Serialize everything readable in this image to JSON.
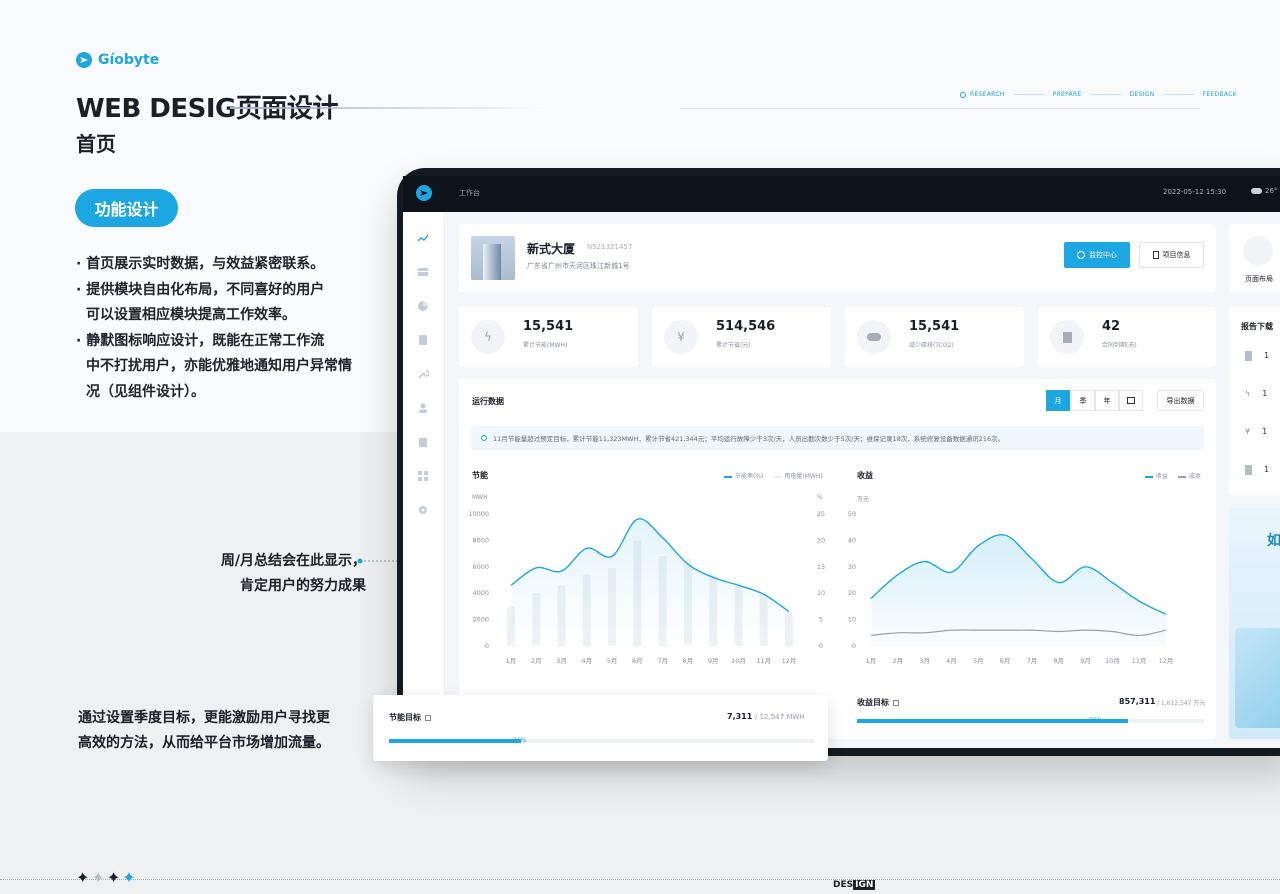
{
  "brand": {
    "name": "Gíobyte"
  },
  "header": {
    "title": "WEB DESIG页面设计",
    "subtitle": "首页"
  },
  "steps": [
    "RESEARCH",
    "PREPARE",
    "DESIGN",
    "FEEDBACK"
  ],
  "left": {
    "button": "功能设计",
    "bullets": [
      "· 首页展示实时数据，与效益紧密联系。",
      "· 提供模块自由化布局，不同喜好的用户",
      "  可以设置相应模块提高工作效率。",
      "· 静默图标响应设计，既能在正常工作流",
      "  中不打扰用户，亦能优雅地通知用户异常情",
      "  况（见组件设计）。"
    ],
    "note1": [
      "周/月总结会在此显示，",
      "肯定用户的努力成果"
    ],
    "note2": [
      "通过设置季度目标，更能激励用户寻找更",
      "高效的方法，从而给平台市场增加流量。"
    ]
  },
  "app": {
    "topbar": {
      "section": "工作台",
      "datetime": "2022-05-12  15:30",
      "weather": "26°"
    },
    "project": {
      "name": "新式大厦",
      "id": "NS21321457",
      "address": "广东省广州市天河区珠江新城1号",
      "monitor_btn": "监控中心",
      "info_btn": "项目信息"
    },
    "stats": [
      {
        "icon": "lightning-icon",
        "value": "15,541",
        "label": "累计节能(MWH)"
      },
      {
        "icon": "yen-icon",
        "value": "514,546",
        "label": "累计节省(元)"
      },
      {
        "icon": "cloud-icon",
        "value": "15,541",
        "label": "减少碳排(TCO2)"
      },
      {
        "icon": "document-icon",
        "value": "42",
        "label": "合同到期(天)"
      }
    ],
    "runtime": {
      "title": "运行数据",
      "periods": [
        "月",
        "季",
        "年"
      ],
      "export": "导出数据",
      "notice": "11月节能量超过预定目标，累计节能11,323MWH，累计节省421,344元；平均运行故障少于3次/天，人员出勤次数少于5次/天；维保记录18次，系统修复设备数据通讯216次。"
    },
    "right_panel": {
      "layout_label": "页面布局",
      "report_title": "报告下载",
      "report_icons": [
        "document-icon",
        "lightning-icon",
        "yen-icon",
        "document-icon"
      ],
      "report_digits": [
        "1",
        "1",
        "1",
        "1"
      ],
      "banner_text": "如"
    },
    "goals": [
      {
        "label": "节能目标",
        "value": "7,311",
        "sep": "/",
        "total": "12,547",
        "unit": "MWH",
        "progress": "31%",
        "fraction": 0.31
      },
      {
        "label": "收益目标",
        "value": "857,311",
        "sep": "/",
        "total": "1,612,547",
        "unit": "万元",
        "progress": "78%",
        "fraction": 0.78
      }
    ]
  },
  "chart_data": [
    {
      "type": "bar",
      "title": "节能",
      "categories": [
        "1月",
        "2月",
        "3月",
        "4月",
        "5月",
        "6月",
        "7月",
        "8月",
        "9月",
        "10月",
        "11月",
        "12月"
      ],
      "series": [
        {
          "name": "节能率(%)",
          "type": "line",
          "axis": "right",
          "values": [
            11.5,
            14.8,
            14.2,
            18.5,
            17.0,
            24.0,
            20.5,
            15.5,
            13.0,
            11.5,
            9.8,
            6.5
          ]
        },
        {
          "name": "用电量(MWH)",
          "type": "bar",
          "axis": "left",
          "values": [
            3000,
            4000,
            4600,
            5400,
            5900,
            8000,
            6800,
            6600,
            5400,
            4800,
            4000,
            2400
          ]
        }
      ],
      "ylabel": "MWH",
      "ylim": [
        0,
        10000
      ],
      "yticks": [
        "0",
        "2000",
        "4000",
        "6000",
        "8000",
        "10000"
      ],
      "y2label": "%",
      "y2lim": [
        0,
        25
      ],
      "y2ticks": [
        "0",
        "5",
        "10",
        "15",
        "20",
        "25"
      ],
      "legend": "top-right"
    },
    {
      "type": "area",
      "title": "收益",
      "categories": [
        "1月",
        "2月",
        "3月",
        "4月",
        "5月",
        "6月",
        "7月",
        "8月",
        "9月",
        "10月",
        "11月",
        "12月"
      ],
      "series": [
        {
          "name": "收益",
          "values": [
            18,
            27,
            32,
            28,
            38,
            42,
            33,
            24,
            30,
            24,
            17,
            12
          ]
        },
        {
          "name": "成本",
          "values": [
            4,
            5,
            5,
            6,
            6,
            6,
            6,
            5.5,
            6,
            5.5,
            4,
            6
          ]
        }
      ],
      "ylabel": "万元",
      "ylim": [
        0,
        50
      ],
      "yticks": [
        "0",
        "10",
        "20",
        "30",
        "40",
        "50"
      ],
      "legend": "top-right"
    }
  ],
  "footer": {
    "tag_a": "DES",
    "tag_b": "IGN"
  }
}
